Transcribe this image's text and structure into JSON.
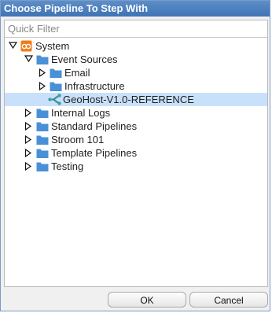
{
  "dialog": {
    "title": "Choose Pipeline To Step With"
  },
  "filter": {
    "placeholder": "Quick Filter",
    "value": ""
  },
  "tree": {
    "items": [
      {
        "label": "System",
        "icon": "system-icon",
        "expanded": true
      },
      {
        "label": "Event Sources",
        "icon": "folder-icon",
        "expanded": true
      },
      {
        "label": "Email",
        "icon": "folder-icon",
        "expanded": false
      },
      {
        "label": "Infrastructure",
        "icon": "folder-icon",
        "expanded": false
      },
      {
        "label": "GeoHost-V1.0-REFERENCE",
        "icon": "pipeline-icon",
        "selected": true
      },
      {
        "label": "Internal Logs",
        "icon": "folder-icon",
        "expanded": false
      },
      {
        "label": "Standard Pipelines",
        "icon": "folder-icon",
        "expanded": false
      },
      {
        "label": "Stroom 101",
        "icon": "folder-icon",
        "expanded": false
      },
      {
        "label": "Template Pipelines",
        "icon": "folder-icon",
        "expanded": false
      },
      {
        "label": "Testing",
        "icon": "folder-icon",
        "expanded": false
      }
    ]
  },
  "buttons": {
    "ok_label": "OK",
    "cancel_label": "Cancel"
  },
  "colors": {
    "title_bar": "#4a7fbf",
    "folder": "#4a90d9",
    "selection": "#c9e0fb",
    "system_icon": "#f07d1a",
    "pipeline_icon": "#3aa0a0"
  }
}
